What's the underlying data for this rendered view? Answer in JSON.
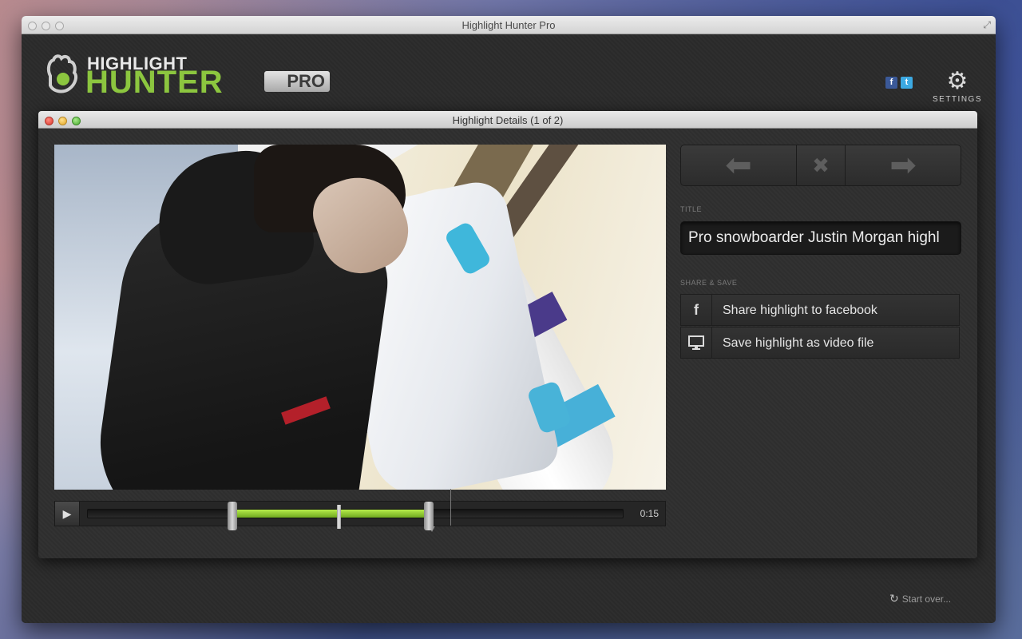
{
  "window": {
    "title": "Highlight Hunter Pro"
  },
  "logo": {
    "line1": "HIGHLIGHT",
    "line2": "HUNTER",
    "badge": "PRO"
  },
  "social": {
    "facebook": "f",
    "twitter": "t"
  },
  "settings": {
    "label": "SETTINGS"
  },
  "dialog": {
    "title": "Highlight Details (1 of 2)"
  },
  "player": {
    "time": "0:15",
    "play_symbol": "▶",
    "selection_start": 0.27,
    "selection_end": 0.63,
    "playhead": 0.676
  },
  "navigation": {
    "prev_symbol": "⬅",
    "close_symbol": "✖",
    "next_symbol": "➡"
  },
  "title_section": {
    "label": "TITLE",
    "value": "Pro snowboarder Justin Morgan highl"
  },
  "share_section": {
    "label": "SHARE & SAVE",
    "items": [
      {
        "icon": "facebook-icon",
        "glyph": "f",
        "label": "Share highlight to facebook"
      },
      {
        "icon": "monitor-icon",
        "glyph": "🖵",
        "label": "Save highlight as video file"
      }
    ]
  },
  "footer": {
    "start_over": "Start over..."
  },
  "colors": {
    "accent_green": "#8cc63f",
    "background": "#2b2b2b"
  }
}
